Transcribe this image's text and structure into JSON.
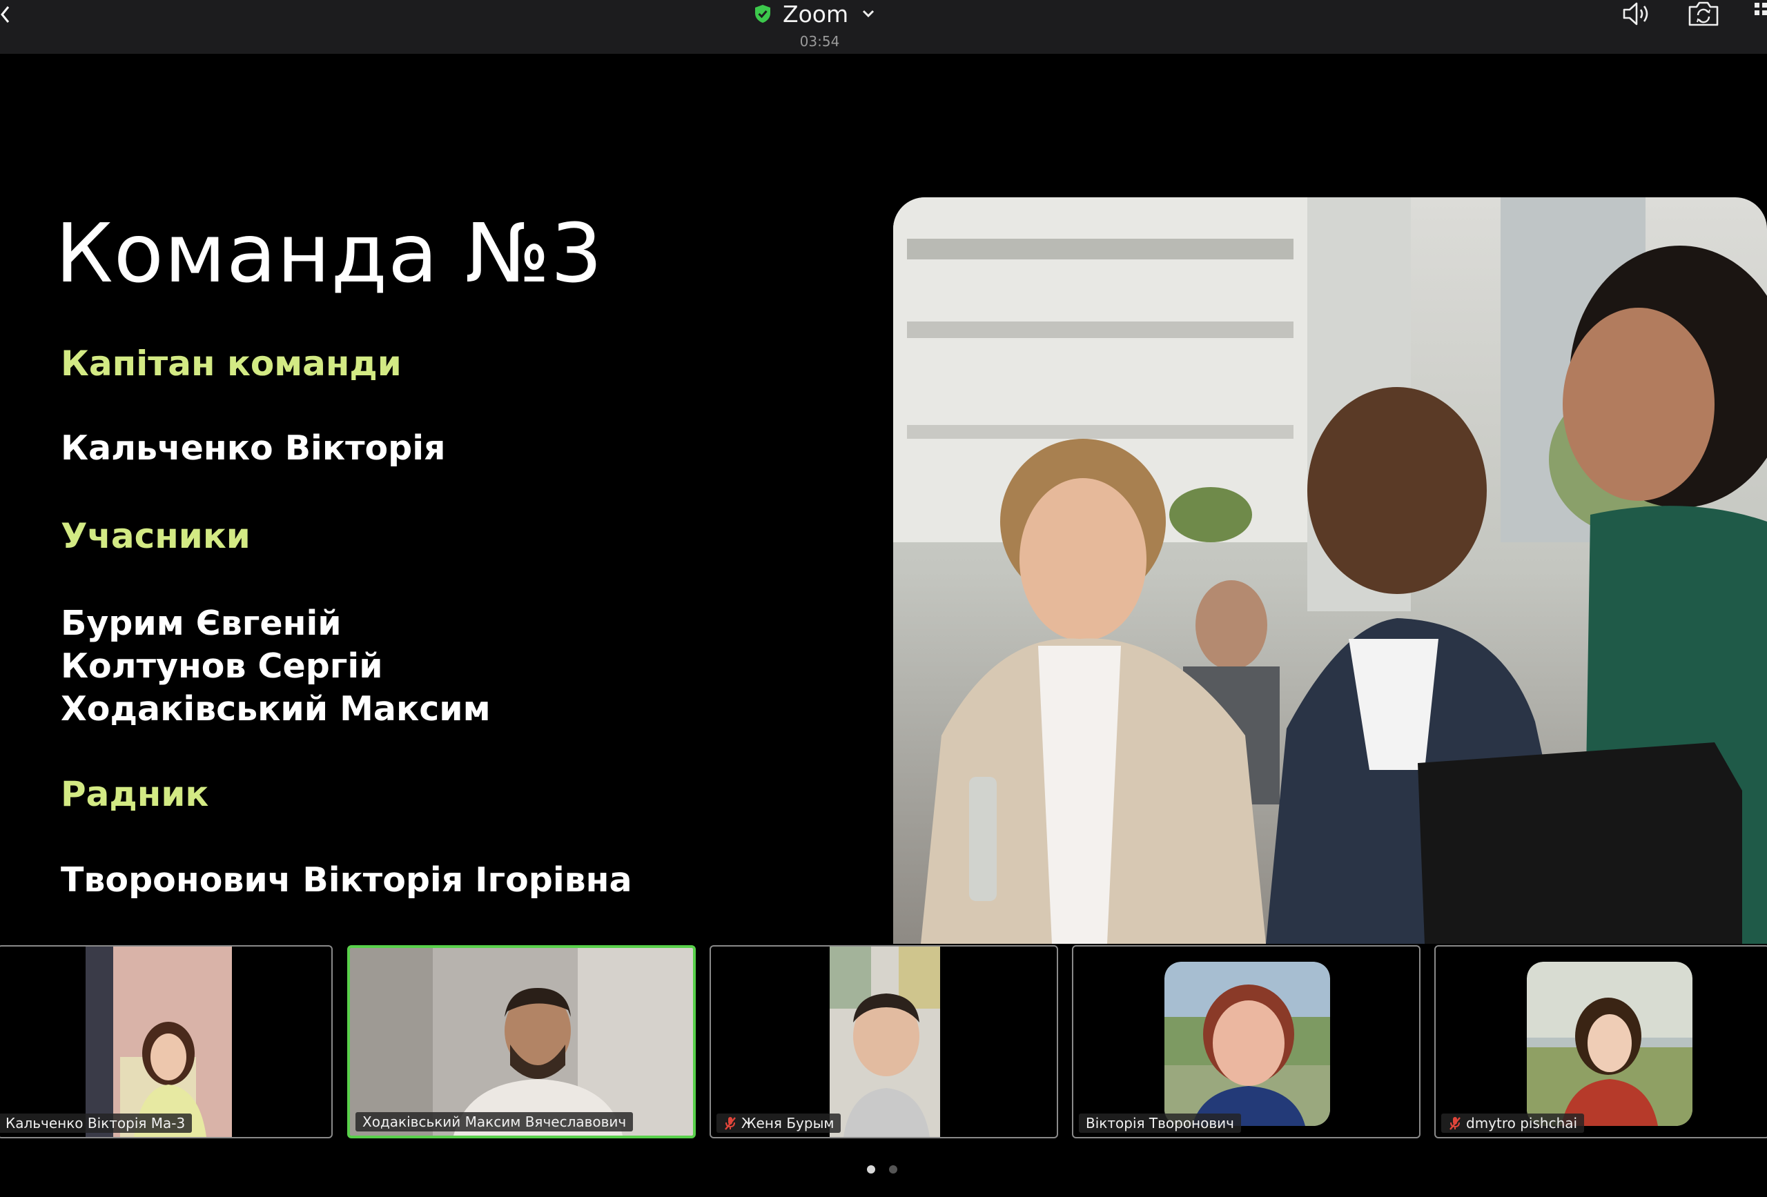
{
  "topbar": {
    "app_title": "Zoom",
    "timer": "03:54",
    "icons": [
      "back-icon",
      "shield-check-icon",
      "chevron-down-icon",
      "speaker-icon",
      "camera-switch-icon",
      "grid-icon"
    ],
    "shield_color": "#3cc84c"
  },
  "slide": {
    "title": "Команда №3",
    "captain_heading": "Капітан команди",
    "captain_name": "Кальченко Вікторія",
    "members_heading": "Учасники",
    "members": [
      "Бурим Євгеній",
      "Колтунов Сергій",
      "Ходаківський Максим"
    ],
    "advisor_heading": "Радник",
    "advisor_name": "Творонович Вікторія Ігорівна",
    "heading_color": "#d3ea84"
  },
  "participants": [
    {
      "name": "Кальченко Вікторія Ма-3",
      "muted": false,
      "active": false
    },
    {
      "name": "Ходаківський Максим Вячеславович",
      "muted": false,
      "active": true
    },
    {
      "name": "Женя Бурым",
      "muted": true,
      "active": false
    },
    {
      "name": "Вікторія Творонович",
      "muted": false,
      "active": false
    },
    {
      "name": "dmytro pishchai",
      "muted": true,
      "active": false
    }
  ],
  "pager": {
    "pages": 2,
    "current": 1
  },
  "colors": {
    "active_speaker": "#58d04a",
    "muted": "#e0453a"
  }
}
